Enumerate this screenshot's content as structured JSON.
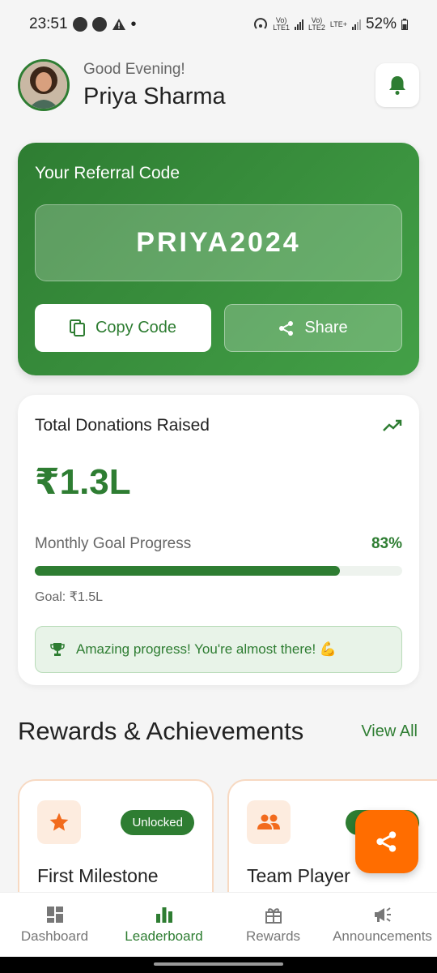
{
  "status_bar": {
    "time": "23:51",
    "net1": "Vo)\nLTE1",
    "net2": "Vo)\nLTE2",
    "lte": "LTE+",
    "battery": "52%"
  },
  "header": {
    "greeting": "Good Evening!",
    "user_name": "Priya Sharma"
  },
  "referral": {
    "title": "Your Referral Code",
    "code": "PRIYA2024",
    "copy_label": "Copy Code",
    "share_label": "Share"
  },
  "donations": {
    "title": "Total Donations Raised",
    "amount": "₹1.3L",
    "goal_label": "Monthly Goal Progress",
    "goal_percent_text": "83%",
    "goal_percent": 0.83,
    "goal_text": "Goal: ₹1.5L",
    "message": "Amazing progress! You're almost there! 💪"
  },
  "rewards": {
    "title": "Rewards & Achievements",
    "view_all": "View All",
    "items": [
      {
        "name": "First Milestone",
        "status": "Unlocked",
        "icon": "star-icon"
      },
      {
        "name": "Team Player",
        "status": "Unlocked",
        "icon": "people-icon"
      }
    ]
  },
  "nav": {
    "items": [
      {
        "label": "Dashboard",
        "icon": "dashboard-icon"
      },
      {
        "label": "Leaderboard",
        "icon": "leaderboard-icon",
        "active": true
      },
      {
        "label": "Rewards",
        "icon": "gift-icon"
      },
      {
        "label": "Announcements",
        "icon": "megaphone-icon"
      }
    ]
  },
  "colors": {
    "primary": "#2e7d32",
    "accent": "#ff6d00",
    "background": "#f5f5f5"
  }
}
